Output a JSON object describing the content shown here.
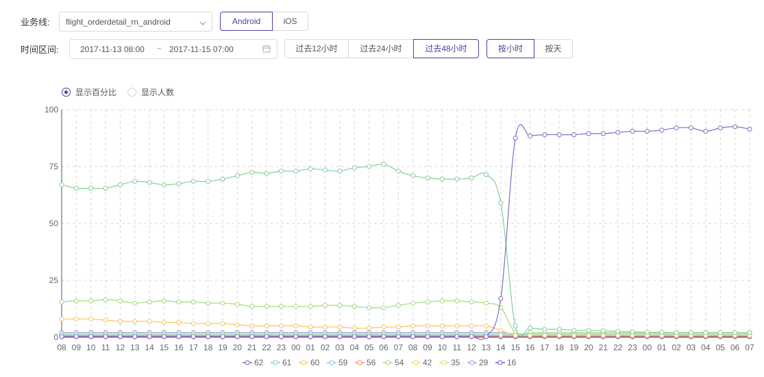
{
  "filters": {
    "business_line_label": "业务线:",
    "business_line_value": "flight_orderdetail_rn_android",
    "platforms": [
      {
        "label": "Android",
        "active": true
      },
      {
        "label": "iOS",
        "active": false
      }
    ],
    "time_range_label": "时间区间:",
    "start_time": "2017-11-13 08:00",
    "range_sep": "~",
    "end_time": "2017-11-15 07:00",
    "quick_ranges": [
      {
        "label": "过去12小时",
        "active": false
      },
      {
        "label": "过去24小时",
        "active": false
      },
      {
        "label": "过去48小时",
        "active": true
      }
    ],
    "granularity": [
      {
        "label": "按小时",
        "active": true
      },
      {
        "label": "按天",
        "active": false
      }
    ]
  },
  "display_mode": {
    "options": [
      {
        "label": "显示百分比",
        "selected": true
      },
      {
        "label": "显示人数",
        "selected": false
      }
    ]
  },
  "icons": {
    "select_arrow": "chevron-down-icon",
    "date_picker": "calendar-icon"
  },
  "colors": {
    "accent": "#4e3f9c",
    "s62": "#7b6fc6",
    "s61": "#7fcf98",
    "s60": "#f7c460",
    "s59": "#7ec8e3",
    "s56": "#f28c5e",
    "s54": "#a3d977",
    "s42": "#f5d24f",
    "s35": "#d4e36b",
    "s29": "#9a9ae6",
    "s16": "#6a5fc1"
  },
  "chart_data": {
    "type": "line",
    "x": [
      "08",
      "09",
      "10",
      "11",
      "12",
      "13",
      "14",
      "15",
      "16",
      "17",
      "18",
      "19",
      "20",
      "21",
      "22",
      "23",
      "00",
      "01",
      "02",
      "03",
      "04",
      "05",
      "06",
      "07",
      "08",
      "09",
      "10",
      "11",
      "12",
      "13",
      "14",
      "15",
      "16",
      "17",
      "18",
      "19",
      "20",
      "21",
      "22",
      "23",
      "00",
      "01",
      "02",
      "03",
      "04",
      "05",
      "06",
      "07"
    ],
    "ylim": [
      0,
      100
    ],
    "yticks": [
      0,
      25,
      50,
      75,
      100
    ],
    "grid": true,
    "legend_position": "bottom",
    "series": [
      {
        "name": "62",
        "color": "#7b6fc6",
        "values": [
          0.3,
          0.3,
          0.3,
          0.3,
          0.3,
          0.3,
          0.3,
          0.3,
          0.3,
          0.3,
          0.3,
          0.3,
          0.3,
          0.3,
          0.3,
          0.3,
          0.3,
          0.3,
          0.3,
          0.3,
          0.3,
          0.3,
          0.3,
          0.3,
          0.3,
          0.3,
          0.3,
          0.3,
          0.3,
          0.3,
          17,
          87.5,
          88.5,
          89,
          89,
          89,
          89.5,
          89.5,
          90,
          90.5,
          90.5,
          91,
          92,
          92,
          90.5,
          92,
          92.5,
          91.5
        ]
      },
      {
        "name": "61",
        "color": "#7fcf98",
        "values": [
          67,
          65.5,
          65.5,
          65.5,
          67,
          68.5,
          68,
          67,
          67.5,
          68.5,
          68.5,
          69.5,
          71,
          72.5,
          72,
          73,
          73,
          74,
          73.5,
          73,
          74.5,
          75,
          76,
          73,
          71,
          70,
          69.5,
          69.5,
          70,
          71.5,
          59,
          5,
          4,
          3.5,
          3.5,
          3,
          3,
          2.8,
          2.6,
          2.4,
          2.2,
          2.2,
          2,
          2,
          2,
          2,
          2,
          2
        ]
      },
      {
        "name": "60",
        "color": "#f7c460",
        "values": [
          8,
          8,
          8,
          7.5,
          7,
          7,
          7,
          6.5,
          6.5,
          6,
          6,
          6,
          5.5,
          5,
          5,
          5,
          5,
          4.5,
          4.5,
          4.5,
          4,
          4,
          4.5,
          4.5,
          5,
          5,
          5,
          5,
          5,
          5,
          3,
          0.8,
          0.8,
          0.8,
          0.8,
          0.8,
          0.8,
          0.8,
          0.8,
          0.8,
          0.8,
          0.8,
          0.8,
          0.8,
          0.8,
          0.8,
          0.8,
          0.8
        ]
      },
      {
        "name": "59",
        "color": "#7ec8e3",
        "values": [
          1,
          1,
          1,
          1,
          1,
          1,
          1,
          1,
          1,
          1,
          1,
          1,
          1,
          1,
          1,
          1,
          1,
          1,
          1,
          1,
          1,
          1,
          1,
          1,
          1,
          1,
          1,
          1,
          1,
          1,
          1,
          1,
          1,
          1,
          1,
          1,
          1,
          1,
          1,
          1,
          1,
          1,
          1,
          1,
          1,
          1,
          1,
          1
        ]
      },
      {
        "name": "56",
        "color": "#f28c5e",
        "values": [
          0.5,
          0.5,
          0.5,
          0.5,
          0.5,
          0.5,
          0.5,
          0.5,
          0.5,
          0.5,
          0.5,
          0.5,
          0.5,
          0.5,
          0.5,
          0.5,
          0.5,
          0.5,
          0.5,
          0.5,
          0.5,
          0.5,
          0.5,
          0.5,
          0.5,
          0.5,
          0.5,
          0.5,
          0.5,
          0.5,
          0.5,
          0.5,
          0.5,
          0.5,
          0.5,
          0.5,
          0.5,
          0.5,
          0.5,
          0.5,
          0.5,
          0.5,
          0.5,
          0.5,
          0.5,
          0.5,
          0.5,
          0.5
        ]
      },
      {
        "name": "54",
        "color": "#a3d977",
        "values": [
          15.5,
          16,
          16,
          16.5,
          16,
          15,
          15.5,
          16,
          15.5,
          15.5,
          15,
          15,
          14.5,
          13.5,
          13.5,
          13.5,
          13.5,
          13.5,
          14,
          14,
          13.5,
          13,
          13,
          14,
          15,
          15.5,
          16,
          16,
          15.5,
          15,
          13,
          2,
          2,
          2,
          2,
          2,
          2,
          2,
          2,
          2,
          2,
          2,
          2,
          2,
          2,
          2,
          2,
          2
        ]
      },
      {
        "name": "42",
        "color": "#f5d24f",
        "values": [
          0.7,
          0.7,
          0.7,
          0.7,
          0.7,
          0.7,
          0.7,
          0.7,
          0.7,
          0.7,
          0.7,
          0.7,
          0.7,
          0.7,
          0.7,
          0.7,
          0.7,
          0.7,
          0.7,
          0.7,
          0.7,
          0.7,
          0.7,
          0.7,
          0.7,
          0.7,
          0.7,
          0.7,
          0.7,
          0.7,
          0.7,
          0.7,
          0.7,
          0.7,
          0.7,
          0.7,
          0.7,
          0.7,
          0.7,
          0.7,
          0.7,
          0.7,
          0.7,
          0.7,
          0.7,
          0.7,
          0.7,
          0.7
        ]
      },
      {
        "name": "35",
        "color": "#d4e36b",
        "values": [
          1.5,
          1.5,
          1.5,
          1.5,
          1.5,
          1.5,
          1.5,
          1.5,
          1.5,
          1.5,
          1.5,
          1.5,
          1.5,
          1.5,
          1.5,
          1.5,
          1.5,
          1.5,
          1.5,
          1.5,
          1.5,
          1.5,
          1.5,
          1.5,
          1.5,
          1.5,
          1.5,
          1.5,
          1.5,
          1.5,
          1.5,
          1.5,
          1.5,
          1.5,
          1.5,
          1.5,
          1.5,
          1.5,
          1.5,
          1.5,
          1.5,
          1.5,
          1.5,
          1.5,
          1.5,
          1.5,
          1.5,
          1.5
        ]
      },
      {
        "name": "29",
        "color": "#9a9ae6",
        "values": [
          2,
          2,
          2,
          2,
          2,
          2,
          2,
          2,
          2,
          2,
          2,
          2,
          2,
          2,
          2,
          2,
          2,
          2,
          2,
          2,
          2,
          2,
          2,
          2,
          2,
          2,
          2,
          2,
          2,
          2,
          2,
          1.5,
          1.5,
          1.5,
          1.5,
          1.5,
          1.5,
          1.5,
          1.5,
          1.5,
          1.5,
          1.5,
          1.5,
          1.5,
          1.5,
          1.5,
          1.5,
          1.5
        ]
      },
      {
        "name": "16",
        "color": "#6a5fc1",
        "values": [
          0.2,
          0.2,
          0.2,
          0.2,
          0.2,
          0.2,
          0.2,
          0.2,
          0.2,
          0.2,
          0.2,
          0.2,
          0.2,
          0.2,
          0.2,
          0.2,
          0.2,
          0.2,
          0.2,
          0.2,
          0.2,
          0.2,
          0.2,
          0.2,
          0.2,
          0.2,
          0.2,
          0.2,
          0.2,
          0.2,
          0.2,
          0.2,
          0.2,
          0.2,
          0.2,
          0.2,
          0.2,
          0.2,
          0.2,
          0.2,
          0.2,
          0.2,
          0.2,
          0.2,
          0.2,
          0.2,
          0.2,
          0.2
        ]
      }
    ]
  }
}
